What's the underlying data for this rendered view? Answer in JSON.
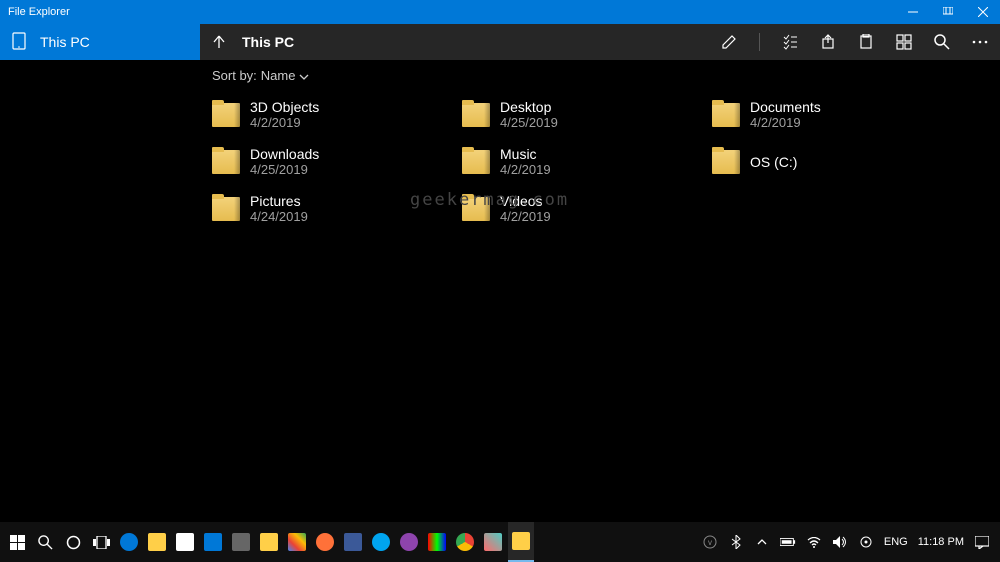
{
  "titlebar": {
    "title": "File Explorer"
  },
  "sidebar": {
    "items": [
      {
        "label": "This PC"
      }
    ]
  },
  "toolbar": {
    "location": "This PC",
    "sort_label": "Sort by:",
    "sort_value": "Name"
  },
  "files": [
    {
      "name": "3D Objects",
      "date": "4/2/2019"
    },
    {
      "name": "Desktop",
      "date": "4/25/2019"
    },
    {
      "name": "Documents",
      "date": "4/2/2019"
    },
    {
      "name": "Downloads",
      "date": "4/25/2019"
    },
    {
      "name": "Music",
      "date": "4/2/2019"
    },
    {
      "name": "OS (C:)",
      "date": ""
    },
    {
      "name": "Pictures",
      "date": "4/24/2019"
    },
    {
      "name": "Videos",
      "date": "4/2/2019"
    }
  ],
  "watermark": "geekermag.com",
  "taskbar": {
    "lang": "ENG",
    "time": "11:18 PM"
  }
}
